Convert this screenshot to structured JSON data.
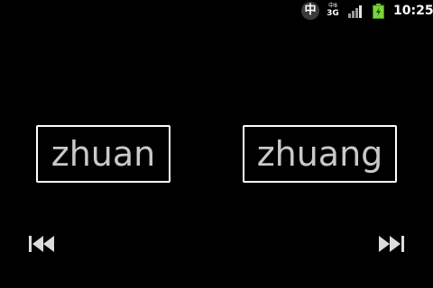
{
  "status_bar": {
    "ime_label": "中",
    "network_type_top": "中8",
    "network_type_bottom": "3G",
    "signal_icon": "signal-bars-icon",
    "battery_icon": "battery-charging-icon",
    "battery_color": "#7bd53a",
    "time": "10:25"
  },
  "pinyin": {
    "left": "zhuan",
    "right": "zhuang"
  },
  "navigation": {
    "previous_icon": "skip-previous-icon",
    "next_icon": "skip-next-icon"
  }
}
